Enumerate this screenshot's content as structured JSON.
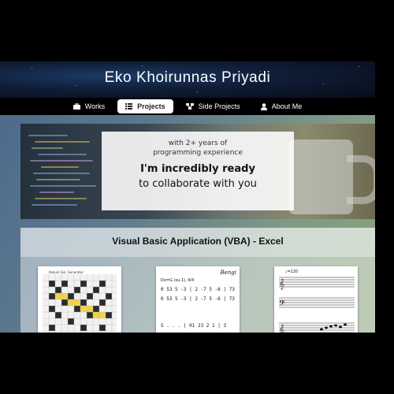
{
  "site": {
    "title": "Eko Khoirunnas Priyadi"
  },
  "nav": [
    {
      "label": "Works",
      "icon": "briefcase-icon",
      "active": false
    },
    {
      "label": "Projects",
      "icon": "list-icon",
      "active": true
    },
    {
      "label": "Side Projects",
      "icon": "sitemap-icon",
      "active": false
    },
    {
      "label": "About Me",
      "icon": "user-icon",
      "active": false
    }
  ],
  "hero": {
    "line1": "with 2+ years of",
    "line2": "programming experience",
    "headline": "I'm incredibly ready",
    "subheadline": "to collaborate with you"
  },
  "section": {
    "title": "Visual Basic Application (VBA) - Excel"
  },
  "thumbs": {
    "score_title": "Bengi",
    "score_header": "Do=G (su.1), 4/4",
    "score_row1": "0  53  5  -3 | 2  -7  5  -6 | 73",
    "score_row2": "0  53  5  -3 | 2  -7  5  -6 | 73",
    "score_row3": "5  .  .  . | 01  23  2  1 | 3",
    "sheet_title": "Kakuro Sol. Generator",
    "tempo": "♩=120"
  },
  "colors": {
    "nav_bg": "#000000",
    "active_tab_bg": "#ffffff",
    "share_bg": "#3a3d42"
  }
}
